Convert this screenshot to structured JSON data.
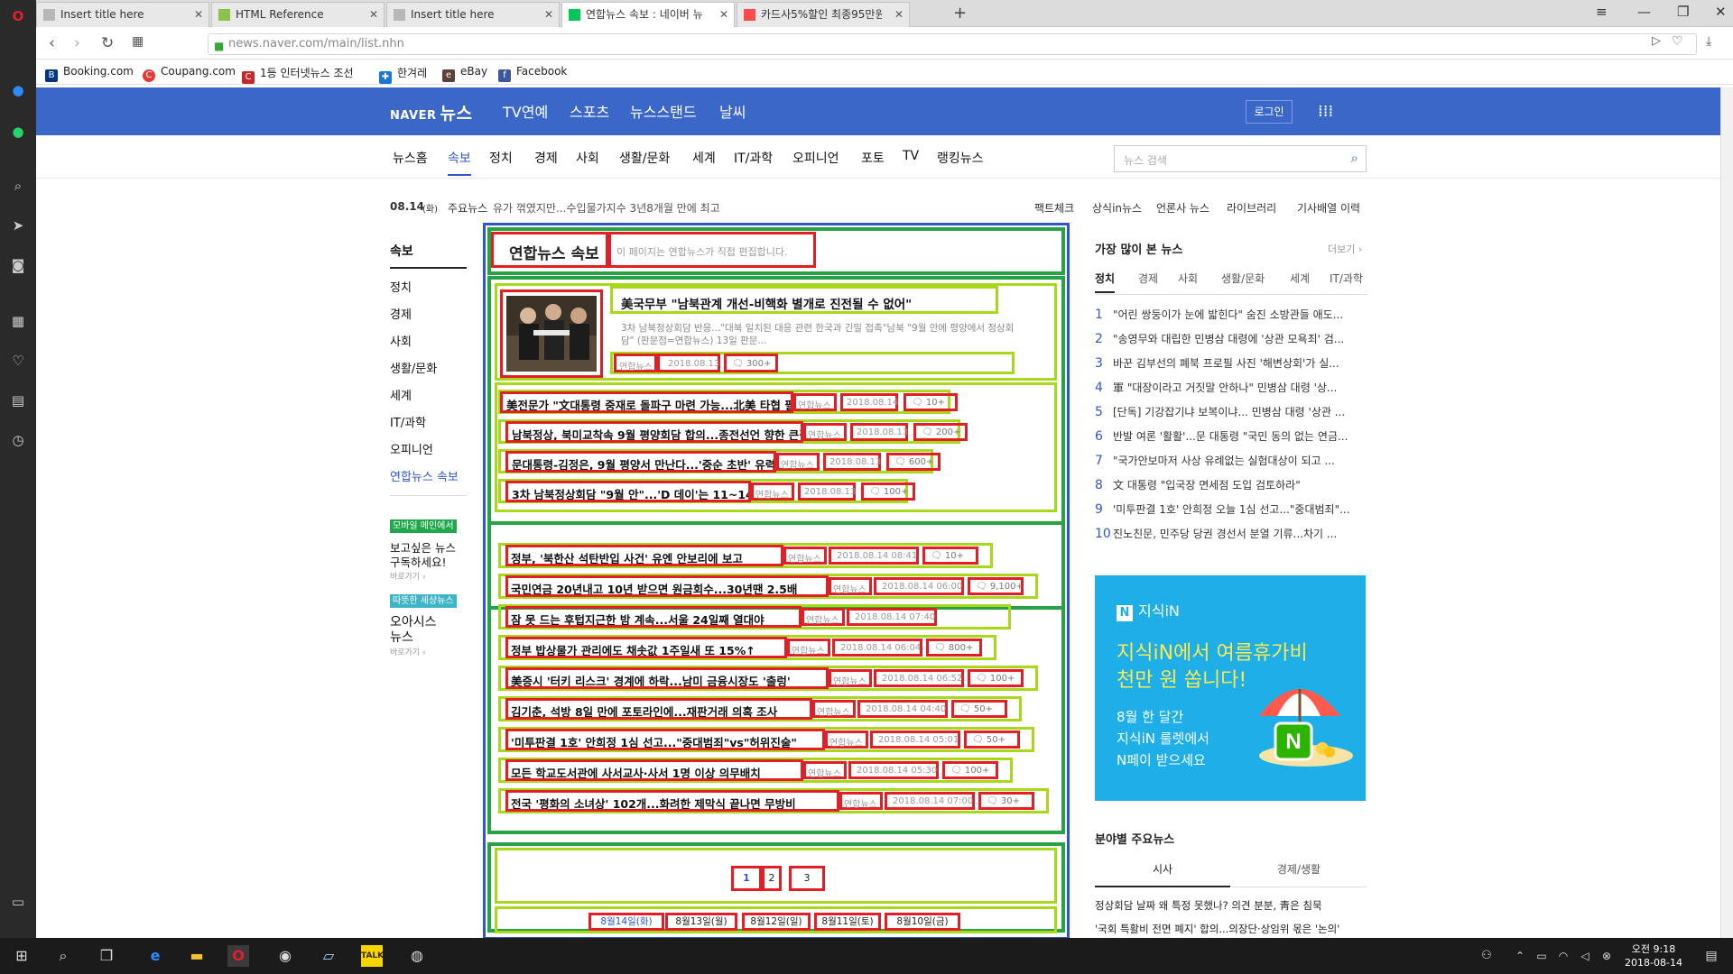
{
  "browser": {
    "tabs": [
      {
        "label": "Insert title here",
        "active": false
      },
      {
        "label": "HTML Reference",
        "active": false
      },
      {
        "label": "Insert title here",
        "active": false
      },
      {
        "label": "연합뉴스 속보 : 네이버 뉴",
        "active": true
      },
      {
        "label": "카드사5%할인 최종95만원",
        "active": false
      }
    ],
    "new_tab": "+",
    "url": "news.naver.com/main/list.nhn",
    "bookmarks": [
      "Booking.com",
      "Coupang.com",
      "1등 인터넷뉴스 조선",
      "한겨레",
      "eBay",
      "Facebook"
    ]
  },
  "header": {
    "logo_naver": "NAVER",
    "logo_news": "뉴스",
    "top_nav": [
      "TV연예",
      "스포츠",
      "뉴스스탠드",
      "날씨"
    ],
    "login": "로그인"
  },
  "categories": [
    "뉴스홈",
    "속보",
    "정치",
    "경제",
    "사회",
    "생활/문화",
    "세계",
    "IT/과학",
    "오피니언",
    "포토",
    "TV",
    "랭킹뉴스"
  ],
  "search": {
    "placeholder": "뉴스 검색"
  },
  "ticker": {
    "date": "08.14",
    "day": "(화)",
    "label": "주요뉴스",
    "text": "유가 꺾였지만...수입물가지수 3년8개월 만에 최고",
    "links": [
      "팩트체크",
      "상식in뉴스",
      "언론사 뉴스",
      "라이브러리",
      "기사배열 이력"
    ]
  },
  "leftnav": {
    "title": "속보",
    "items": [
      "정치",
      "경제",
      "사회",
      "생활/문화",
      "세계",
      "IT/과학",
      "오피니언",
      "연합뉴스 속보"
    ],
    "promo1_badge": "모바일 메인에서",
    "promo1_text1": "보고싶은 뉴스",
    "promo1_text2": "구독하세요!",
    "promo1_link": "바로가기 ›",
    "promo2_badge": "따뜻한 세상뉴스",
    "promo2_text1": "오아시스",
    "promo2_text2": "뉴스",
    "promo2_link": "바로가기 ›"
  },
  "main": {
    "title": "연합뉴스 속보",
    "subtitle": "이 페이지는 연합뉴스가 직접 편집합니다.",
    "featured": {
      "headline": "美국무부 \"남북관계 개선-비핵화 별개로 진전될 수 없어\"",
      "summary": "3차 남북정상회담 반응...\"대북 일치된 대응 관련 한국과 긴밀 접촉\"남북 \"9월 안에 평양에서 정상회담\" (판문점=연합뉴스) 13일 판문...",
      "source": "연합뉴스",
      "date": "2018.08.13",
      "comments": "300+"
    },
    "top_list": [
      {
        "headline": "美전문가 \"文대통령 중재로 돌파구 마련 가능...北美 타협 필요\"",
        "source": "연합뉴스",
        "date": "2018.08.14",
        "comments": "10+"
      },
      {
        "headline": "남북정상, 북미교착속 9월 평양회담 합의...종전선언 향한 큰걸음",
        "source": "연합뉴스",
        "date": "2018.08.13",
        "comments": "200+"
      },
      {
        "headline": "문대통령-김정은, 9월 평양서 만난다...'중순 초반' 유력 거론",
        "source": "연합뉴스",
        "date": "2018.08.13",
        "comments": "600+"
      },
      {
        "headline": "3차 남북정상회담 \"9월 안\"...'D 데이'는 11~14일 유력",
        "source": "연합뉴스",
        "date": "2018.08.13",
        "comments": "100+"
      }
    ],
    "list": [
      {
        "headline": "정부, '북한산 석탄반입 사건' 유엔 안보리에 보고",
        "source": "연합뉴스",
        "date": "2018.08.14 08:41",
        "comments": "10+"
      },
      {
        "headline": "국민연금 20년내고 10년 받으면 원금회수...30년땐 2.5배",
        "source": "연합뉴스",
        "date": "2018.08.14 06:00",
        "comments": "9,100+"
      },
      {
        "headline": "잠 못 드는 후텁지근한 밤 계속...서울 24일째 열대야",
        "source": "연합뉴스",
        "date": "2018.08.14 07:40",
        "comments": ""
      },
      {
        "headline": "정부 밥상물가 관리에도 채솟값 1주일새 또 15%↑",
        "source": "연합뉴스",
        "date": "2018.08.14 06:04",
        "comments": "800+"
      },
      {
        "headline": "美증시 '터키 리스크' 경계에 하락...남미 금융시장도 '출렁'",
        "source": "연합뉴스",
        "date": "2018.08.14 06:52",
        "comments": "100+"
      },
      {
        "headline": "김기춘, 석방 8일 만에 포토라인에...재판거래 의혹 조사",
        "source": "연합뉴스",
        "date": "2018.08.14 04:40",
        "comments": "50+"
      },
      {
        "headline": "'미투판결 1호' 안희정 1심 선고...\"중대범죄\"vs\"허위진술\"",
        "source": "연합뉴스",
        "date": "2018.08.14 05:01",
        "comments": "50+"
      },
      {
        "headline": "모든 학교도서관에 사서교사·사서 1명 이상 의무배치",
        "source": "연합뉴스",
        "date": "2018.08.14 05:30",
        "comments": "100+"
      },
      {
        "headline": "전국 '평화의 소녀상' 102개...화려한 제막식 끝나면 무방비",
        "source": "연합뉴스",
        "date": "2018.08.14 07:00",
        "comments": "30+"
      }
    ],
    "pages": [
      "1",
      "2",
      "3"
    ],
    "dates": [
      "8월14일(화)",
      "8월13일(월)",
      "8월12일(일)",
      "8월11일(토)",
      "8월10일(금)"
    ]
  },
  "right": {
    "popular_title": "가장 많이 본 뉴스",
    "more": "더보기 ›",
    "tabs": [
      "정치",
      "경제",
      "사회",
      "생활/문화",
      "세계",
      "IT/과학"
    ],
    "ranks": [
      {
        "n": "1",
        "text": "\"어린 쌍둥이가 눈에 밟힌다\" 숨진 소방관들 애도..."
      },
      {
        "n": "2",
        "text": "\"송영무와 대립한 민병삼 대령에 '상관 모욕죄' 검..."
      },
      {
        "n": "3",
        "text": "바꾼 김부선의 폐북 프로필 사진 '해변상회'가 실..."
      },
      {
        "n": "4",
        "text": "軍 \"대장이라고 거짓말 안하나\" 민병삼 대령 '상..."
      },
      {
        "n": "5",
        "text": "[단독] 기강잡기냐 보복이냐... 민병삼 대령 '상관 ..."
      },
      {
        "n": "6",
        "text": "반발 여론 '활활'...문 대통령 \"국민 동의 없는 연금..."
      },
      {
        "n": "7",
        "text": "\"국가안보마저 사상 유례없는 실험대상이 되고 ..."
      },
      {
        "n": "8",
        "text": "文 대통령 \"입국장 면세점 도입 검토하라\""
      },
      {
        "n": "9",
        "text": "'미투판결 1호' 안희정 오늘 1심 선고...\"중대범죄\"..."
      },
      {
        "n": "10",
        "text": "진노친문, 민주당 당권 경선서 분열 기류...차기 ..."
      }
    ],
    "ad": {
      "brand": "지식iN",
      "headline1": "지식iN에서 여름휴가비",
      "headline2": "천만 원 쏩니다!",
      "body1": "8월 한 달간",
      "body2": "지식iN 룰렛에서",
      "body3": "N페이 받으세요"
    },
    "section_title": "분야별 주요뉴스",
    "section_tabs": [
      "시사",
      "경제/생활"
    ],
    "section_items": [
      "정상회담 날짜 왜 특정 못했나? 의견 분분, 靑은 침묵",
      "'국회 특활비 전면 폐지' 합의...의장단·상임위 몫은 '논의'"
    ]
  },
  "taskbar": {
    "time": "오전 9:18",
    "date": "2018-08-14"
  }
}
